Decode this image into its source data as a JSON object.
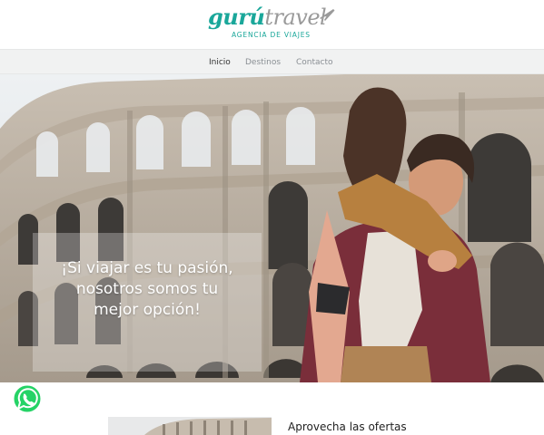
{
  "brand": {
    "logo_part1": "gurú",
    "logo_part2": "travel",
    "tagline": "AGENCIA DE VIAJES",
    "color_primary": "#1aa79a",
    "color_secondary": "#9a9a9a",
    "icon": "airplane-icon"
  },
  "nav": {
    "items": [
      {
        "label": "Inicio",
        "active": true
      },
      {
        "label": "Destinos",
        "active": false
      },
      {
        "label": "Contacto",
        "active": false
      }
    ]
  },
  "hero": {
    "headline": "¡Si viajar es tu pasión, nosotros somos tu mejor opción!",
    "image_subject": "Colosseum with smiling couple"
  },
  "floating": {
    "whatsapp_icon": "whatsapp-icon",
    "whatsapp_color": "#25d366"
  },
  "offers": {
    "title": "Aprovecha las ofertas"
  }
}
